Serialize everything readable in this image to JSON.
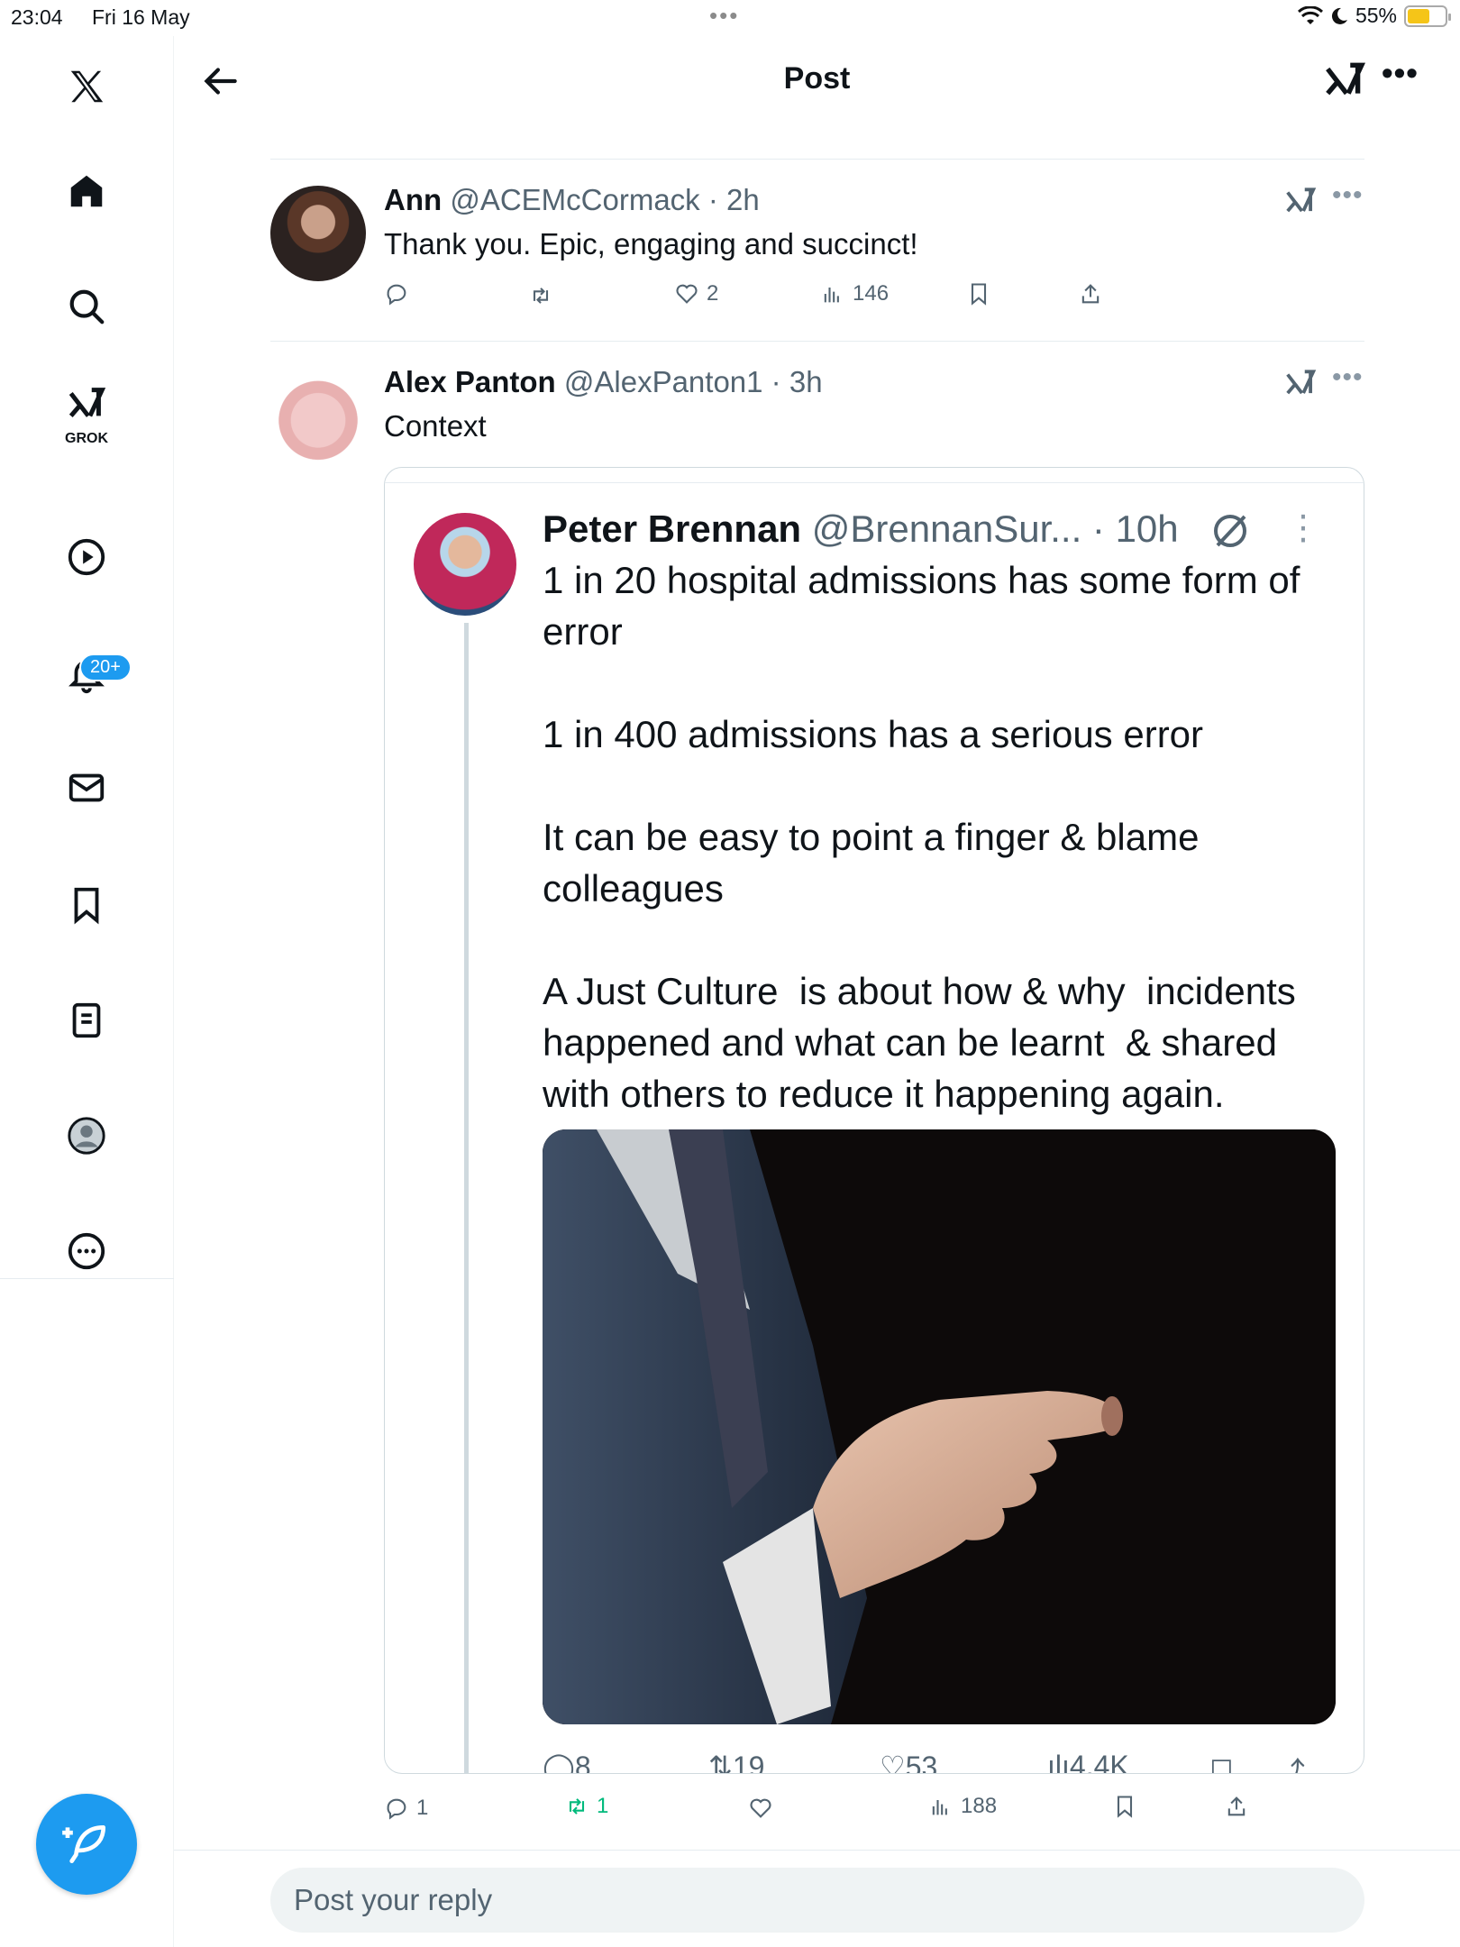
{
  "status_bar": {
    "time": "23:04",
    "date": "Fri 16 May",
    "battery": "55%",
    "dots": "•••"
  },
  "sidebar": {
    "items": [
      "home",
      "explore",
      "grok",
      "video",
      "notifications",
      "messages",
      "bookmarks",
      "lists",
      "profile",
      "more"
    ],
    "grok_label": "GROK",
    "notifications_badge": "20+"
  },
  "header": {
    "title": "Post",
    "more": "•••"
  },
  "replies": [
    {
      "name": "Ann",
      "handle": "@ACEMcCormack",
      "time": "2h",
      "text": "Thank you. Epic, engaging and succinct!",
      "likes": "2",
      "views": "146",
      "more": "•••"
    },
    {
      "name": "Alex Panton",
      "handle": "@AlexPanton1",
      "time": "3h",
      "text": "Context",
      "more": "•••",
      "replies_count": "1",
      "reposts_count": "1",
      "views": "188"
    }
  ],
  "quote": {
    "name": "Peter Brennan",
    "handle": "@BrennanSur...",
    "time": "10h",
    "more": "⋮",
    "text": "1 in 20 hospital admissions has some form of error\n\n1 in 400 admissions has a serious error\n\nIt can be easy to point a finger & blame colleagues\n\nA Just Culture  is about how & why  incidents happened and what can be learnt  & shared with others to reduce it happening again.",
    "replies": "8",
    "reposts": "19",
    "likes": "53",
    "views": "4.4K"
  },
  "reply_box": {
    "placeholder": "Post your reply"
  },
  "colors": {
    "accent": "#1d9bf0",
    "repost_green": "#00ba7c",
    "muted": "#536471"
  }
}
